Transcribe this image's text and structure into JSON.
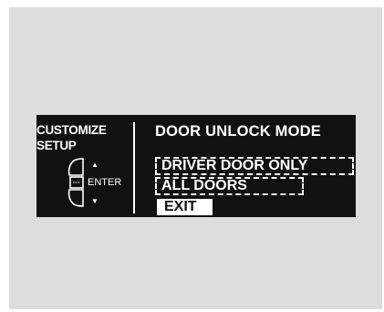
{
  "left": {
    "title_line1": "CUSTOMIZE",
    "title_line2": "SETUP",
    "enter_label": "ENTER",
    "up_arrow": "▲",
    "down_arrow": "▼"
  },
  "right": {
    "title": "DOOR UNLOCK MODE",
    "options": [
      {
        "label": "DRIVER DOOR ONLY"
      },
      {
        "label": "ALL DOORS"
      }
    ],
    "exit_label": "EXIT"
  },
  "colors": {
    "panel_bg": "#dcdddf",
    "display_bg": "#111111",
    "display_fg": "#ffffff"
  },
  "icons": {
    "knob": "selector-knob-icon"
  }
}
